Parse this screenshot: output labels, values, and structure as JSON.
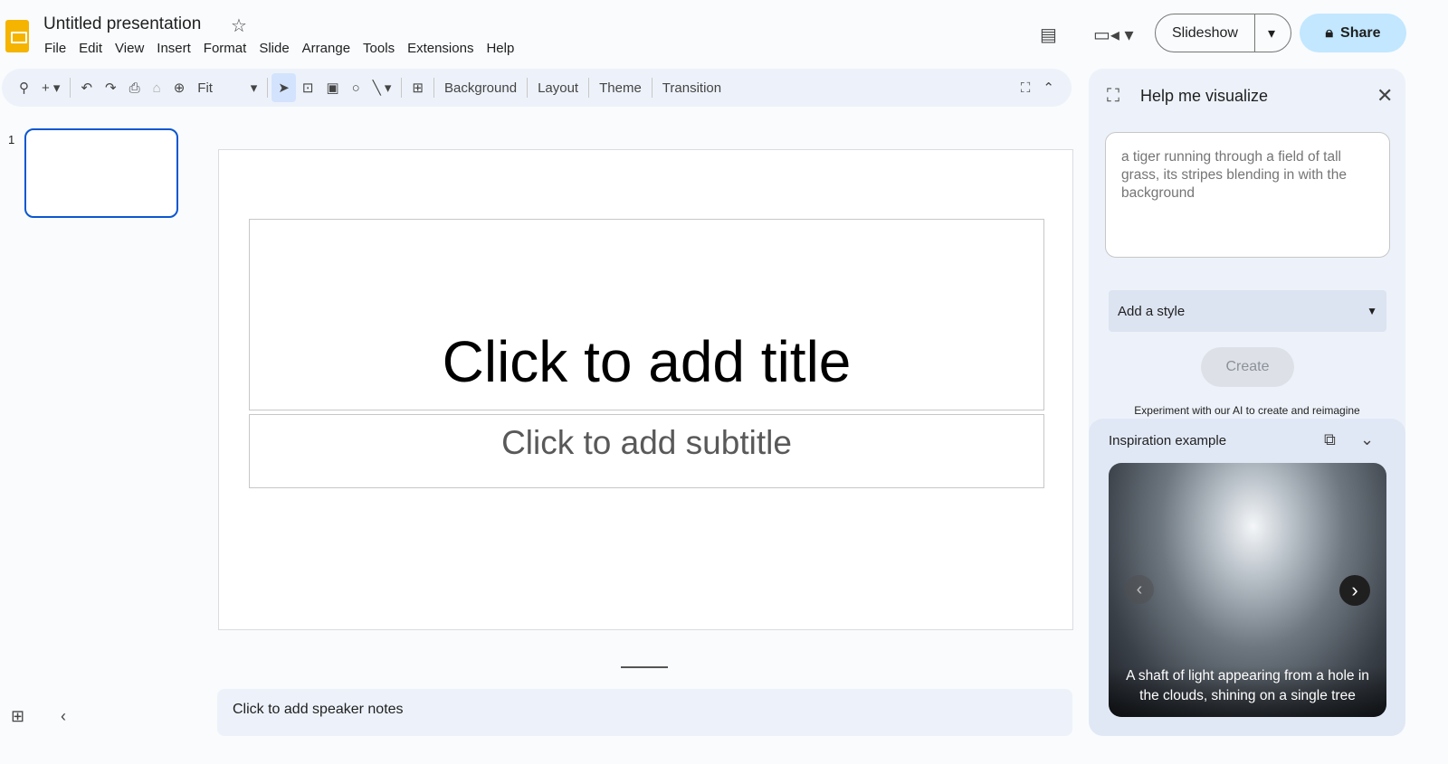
{
  "header": {
    "title": "Untitled presentation",
    "menu": [
      "File",
      "Edit",
      "View",
      "Insert",
      "Format",
      "Slide",
      "Arrange",
      "Tools",
      "Extensions",
      "Help"
    ],
    "slideshow": "Slideshow",
    "share": "Share"
  },
  "toolbar": {
    "zoom": "Fit",
    "buttons": [
      "Background",
      "Layout",
      "Theme",
      "Transition"
    ]
  },
  "slides": {
    "number": "1"
  },
  "slide": {
    "title": "Click to add title",
    "subtitle": "Click to add subtitle"
  },
  "notes": "Click to add speaker notes",
  "panel": {
    "title": "Help me visualize",
    "prompt": "a tiger running through a field of tall grass, its stripes blending in with the background",
    "style": "Add a style",
    "create": "Create",
    "experiment": "Experiment with our AI to create and reimagine",
    "inspiration": "Inspiration example",
    "caption": "A shaft of light appearing from a hole in the clouds, shining on a single tree"
  },
  "colors": {
    "accent": "#0b57d0",
    "share_bg": "#c2e7ff",
    "panel_bg": "#edf2fa"
  }
}
